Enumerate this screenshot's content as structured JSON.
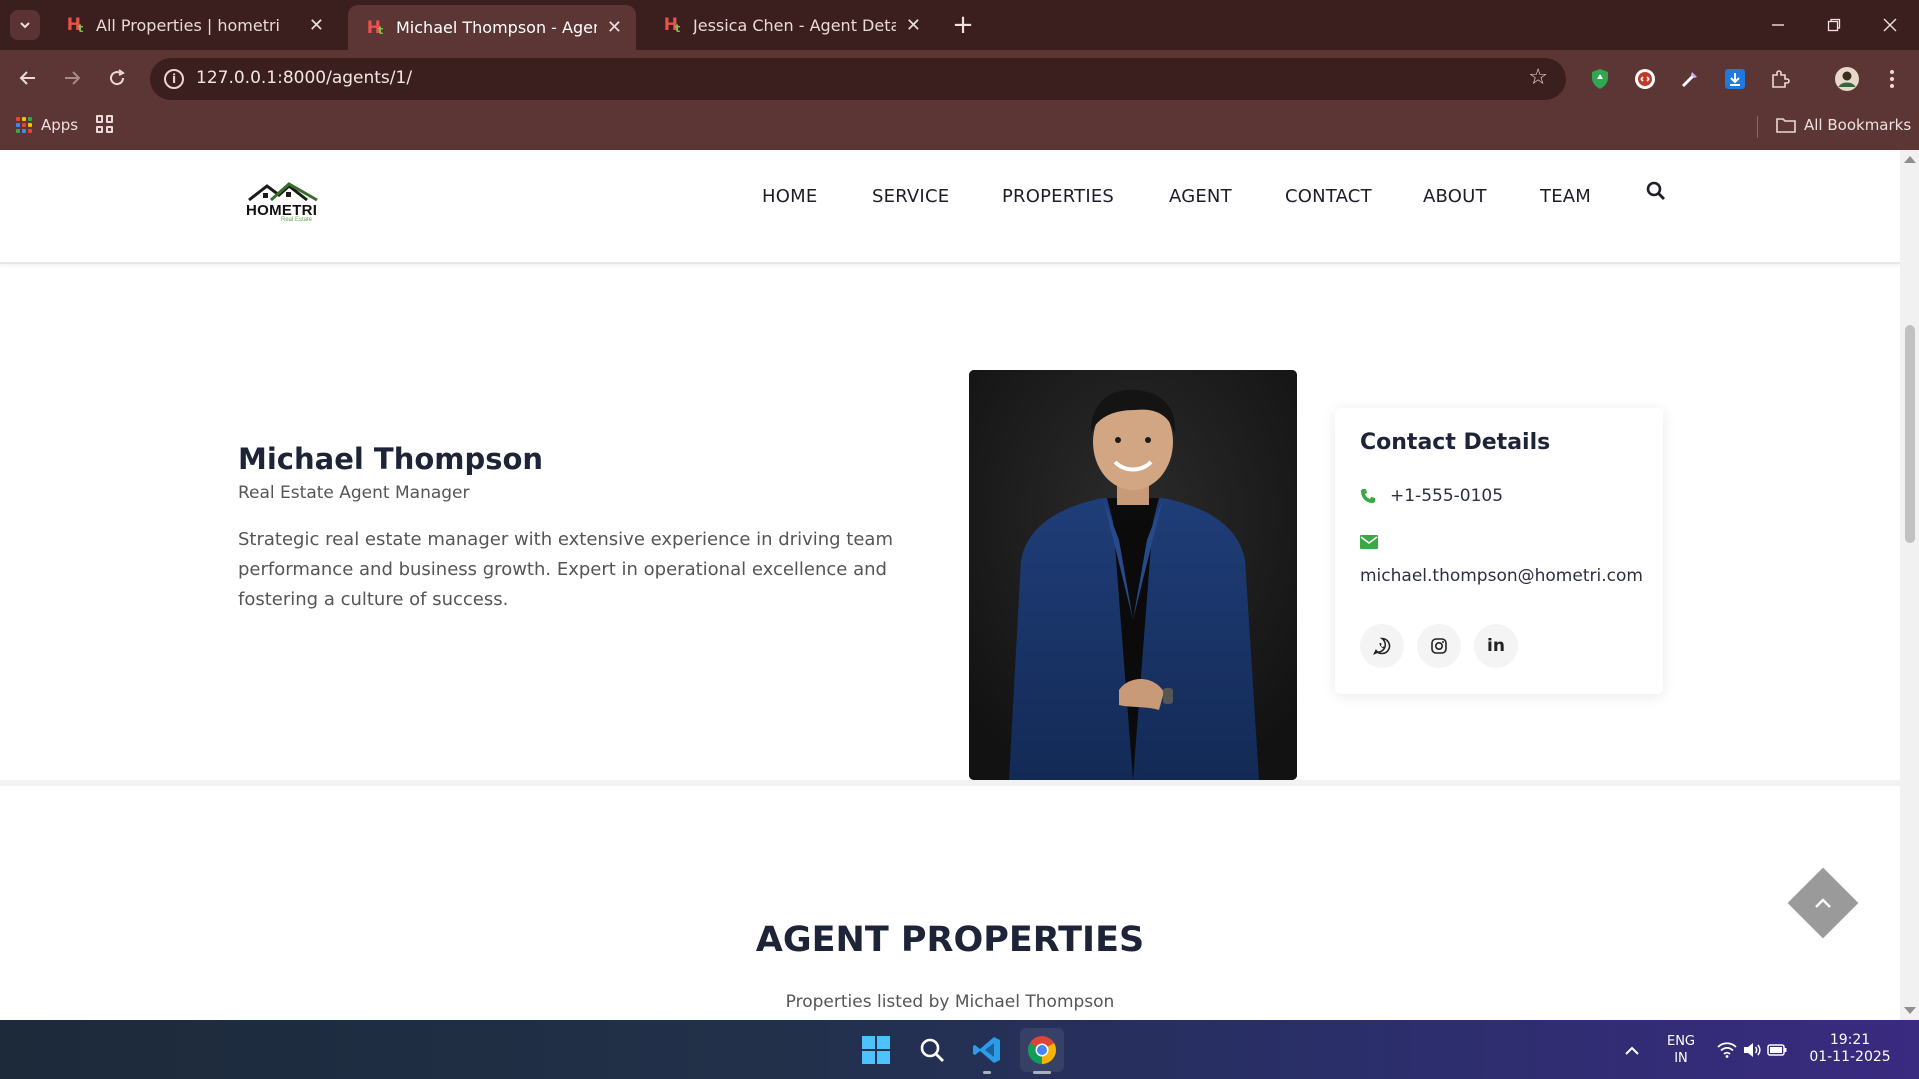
{
  "browser": {
    "tabs": [
      {
        "title": "All Properties | hometri",
        "active": false
      },
      {
        "title": "Michael Thompson - Agent Det",
        "active": true
      },
      {
        "title": "Jessica Chen - Agent Details | h",
        "active": false
      }
    ],
    "url": "127.0.0.1:8000/agents/1/",
    "bookmarks": {
      "apps_label": "Apps",
      "all_bookmarks_label": "All Bookmarks"
    }
  },
  "site": {
    "logo_text": "HOMETRI",
    "logo_sub": "Real Estate",
    "nav": [
      "HOME",
      "SERVICE",
      "PROPERTIES",
      "AGENT",
      "CONTACT",
      "ABOUT",
      "TEAM"
    ]
  },
  "agent": {
    "name": "Michael Thompson",
    "role": "Real Estate Agent Manager",
    "bio": "Strategic real estate manager with extensive experience in driving team performance and business growth. Expert in operational excellence and fostering a culture of success."
  },
  "contact": {
    "title": "Contact Details",
    "phone": "+1-555-0105",
    "email": "michael.thompson@hometri.com",
    "socials": [
      "whatsapp",
      "instagram",
      "linkedin"
    ],
    "accent_color": "#3aa845"
  },
  "properties": {
    "title": "AGENT PROPERTIES",
    "subtitle": "Properties listed by Michael Thompson"
  },
  "taskbar": {
    "language_line1": "ENG",
    "language_line2": "IN",
    "time": "19:21",
    "date": "01-11-2025"
  }
}
